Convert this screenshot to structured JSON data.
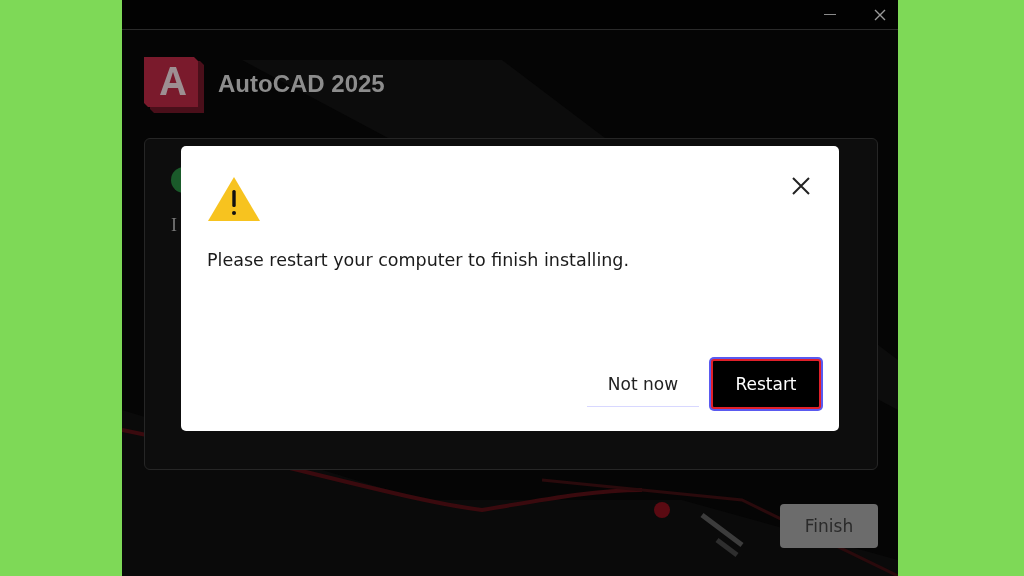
{
  "product": {
    "name": "AutoCAD 2025"
  },
  "panel": {
    "status_text": "I"
  },
  "dialog": {
    "message": "Please restart your computer to finish installing.",
    "buttons": [
      {
        "label": "Not now",
        "kind": "secondary",
        "focused": false
      },
      {
        "label": "Restart",
        "kind": "primary",
        "focused": true
      }
    ]
  },
  "footer": {
    "finish": {
      "label": "Finish",
      "disabled": true
    }
  }
}
